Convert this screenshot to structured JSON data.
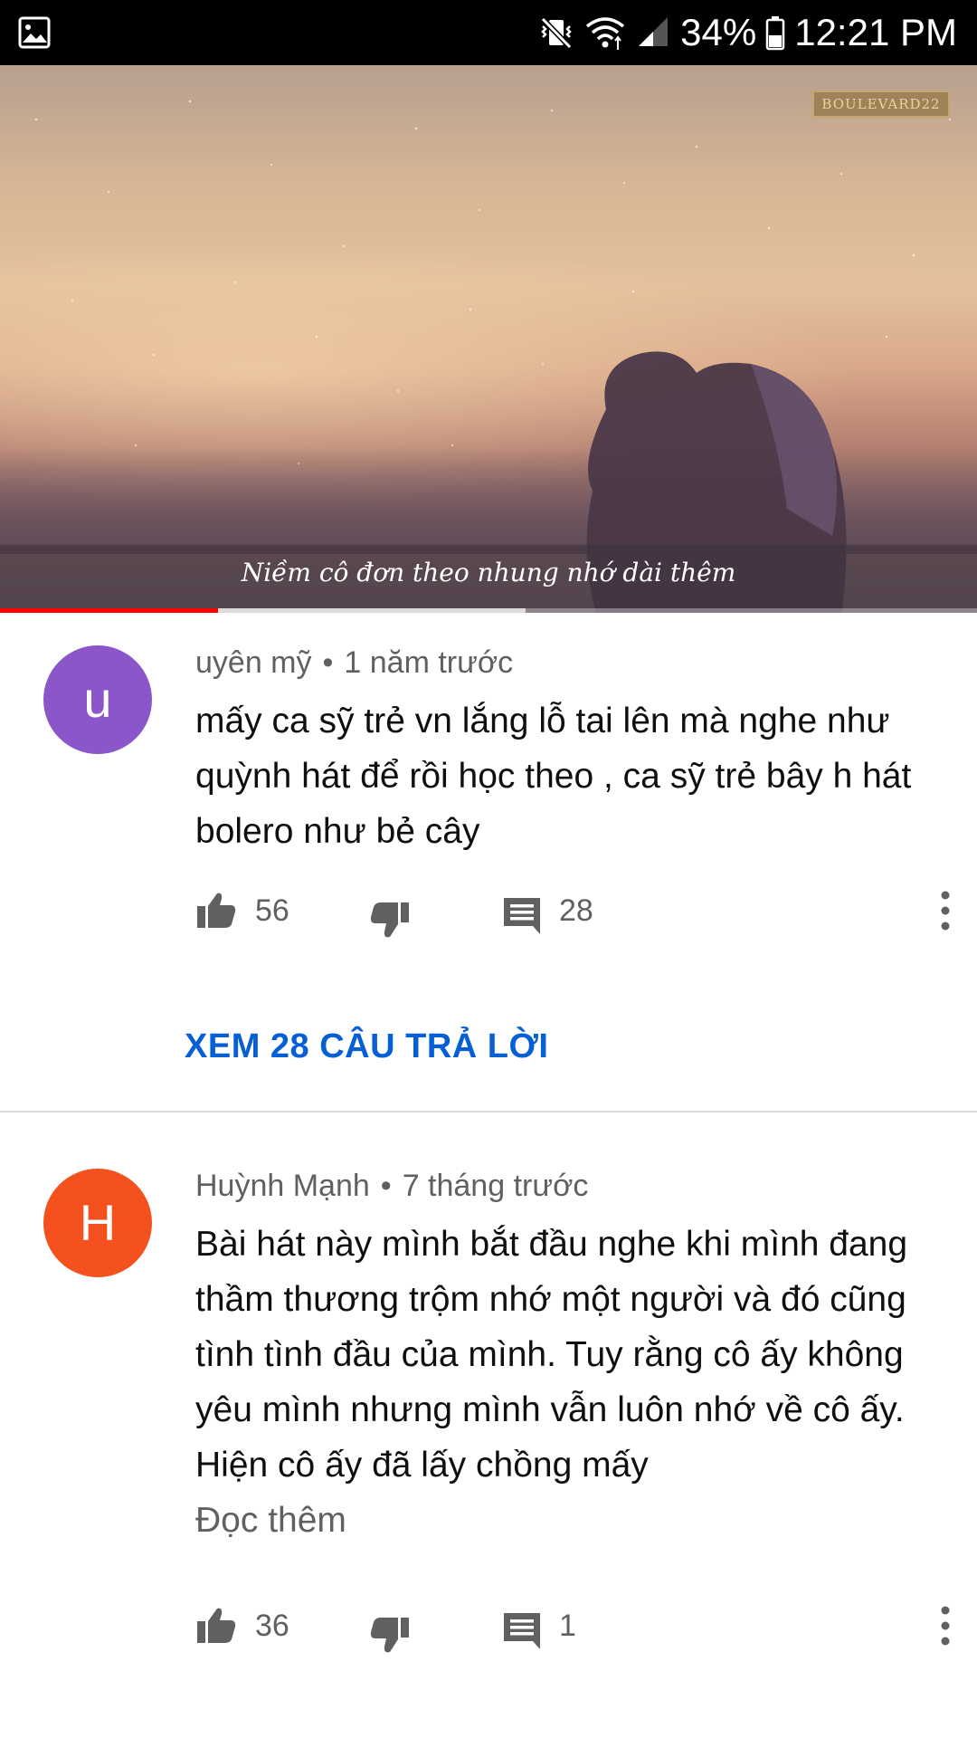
{
  "status_bar": {
    "battery": "34%",
    "time": "12:21 PM",
    "icons": [
      "gallery-icon",
      "vibrate-mute-icon",
      "wifi-icon",
      "signal-icon",
      "battery-icon"
    ]
  },
  "video": {
    "watermark": "BOULEVARD22",
    "subtitle": "Niềm cô đơn theo nhung nhớ dài thêm",
    "progress_played": 0.223,
    "progress_buffered": 0.538
  },
  "comments": [
    {
      "avatar_letter": "u",
      "avatar_color": "#8a56c9",
      "author": "uyên mỹ",
      "separator": "•",
      "time": "1 năm trước",
      "text": "mấy ca sỹ trẻ vn lắng lỗ tai lên mà nghe như quỳnh hát để rồi học theo , ca sỹ trẻ bây h hát bolero như bẻ cây",
      "read_more": "",
      "likes": "56",
      "replies": "28",
      "view_replies": "XEM 28 CÂU TRẢ LỜI"
    },
    {
      "avatar_letter": "H",
      "avatar_color": "#f4511e",
      "author": "Huỳnh Mạnh",
      "separator": "•",
      "time": "7 tháng trước",
      "text": "Bài hát này mình bắt đầu nghe khi mình đang thầm thương trộm nhớ một người và đó cũng tình tình đầu của mình. Tuy rằng cô ấy không yêu mình nhưng mình vẫn luôn nhớ về cô ấy. Hiện cô ấy đã lấy chồng mấy",
      "read_more": "Đọc thêm",
      "likes": "36",
      "replies": "1"
    }
  ],
  "colors": {
    "link_blue": "#065fd4",
    "progress_red": "#ff0000",
    "secondary_text": "#606060"
  }
}
